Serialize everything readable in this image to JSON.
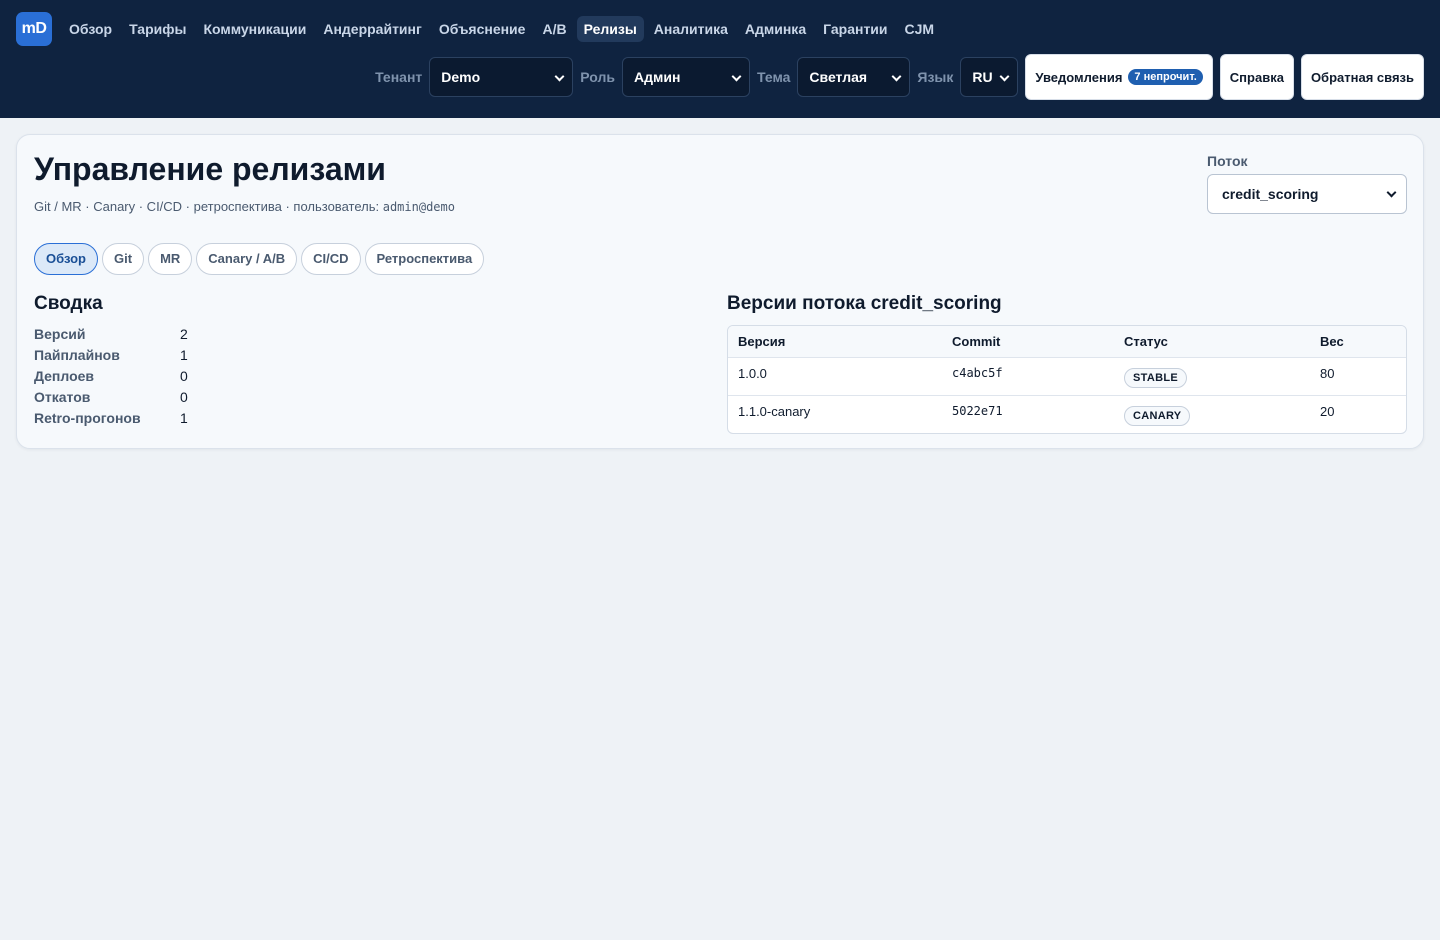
{
  "logo": "mD",
  "nav": [
    {
      "label": "Обзор",
      "active": false
    },
    {
      "label": "Тарифы",
      "active": false
    },
    {
      "label": "Коммуникации",
      "active": false
    },
    {
      "label": "Андеррайтинг",
      "active": false
    },
    {
      "label": "Объяснение",
      "active": false
    },
    {
      "label": "A/B",
      "active": false
    },
    {
      "label": "Релизы",
      "active": true
    },
    {
      "label": "Аналитика",
      "active": false
    },
    {
      "label": "Админка",
      "active": false
    },
    {
      "label": "Гарантии",
      "active": false
    },
    {
      "label": "CJM",
      "active": false
    }
  ],
  "controls": {
    "tenant_label": "Тенант",
    "tenant_value": "Demo",
    "role_label": "Роль",
    "role_value": "Админ",
    "theme_label": "Тема",
    "theme_value": "Светлая",
    "lang_label": "Язык",
    "lang_value": "RU",
    "notifications_label": "Уведомления",
    "notifications_badge": "7 непрочит.",
    "help_label": "Справка",
    "feedback_label": "Обратная связь"
  },
  "page": {
    "title": "Управление релизами",
    "subtitle_prefix": "Git / MR · Canary · CI/CD · ретроспектива · пользователь:",
    "user": "admin@demo",
    "stream_label": "Поток",
    "stream_value": "credit_scoring"
  },
  "tabs": [
    {
      "label": "Обзор",
      "active": true
    },
    {
      "label": "Git",
      "active": false
    },
    {
      "label": "MR",
      "active": false
    },
    {
      "label": "Canary / A/B",
      "active": false
    },
    {
      "label": "CI/CD",
      "active": false
    },
    {
      "label": "Ретроспектива",
      "active": false
    }
  ],
  "summary": {
    "title": "Сводка",
    "rows": [
      {
        "key": "Версий",
        "value": "2"
      },
      {
        "key": "Пайплайнов",
        "value": "1"
      },
      {
        "key": "Деплоев",
        "value": "0"
      },
      {
        "key": "Откатов",
        "value": "0"
      },
      {
        "key": "Retro-прогонов",
        "value": "1"
      }
    ]
  },
  "versions": {
    "title": "Версии потока credit_scoring",
    "headers": [
      "Версия",
      "Commit",
      "Статус",
      "Вес"
    ],
    "rows": [
      {
        "version": "1.0.0",
        "commit": "c4abc5f",
        "status": "STABLE",
        "weight": "80"
      },
      {
        "version": "1.1.0-canary",
        "commit": "5022e71",
        "status": "CANARY",
        "weight": "20"
      }
    ]
  },
  "colors": {
    "topbar": "#0f2340",
    "accent": "#2a6fd6",
    "page_bg": "#eef2f6"
  }
}
